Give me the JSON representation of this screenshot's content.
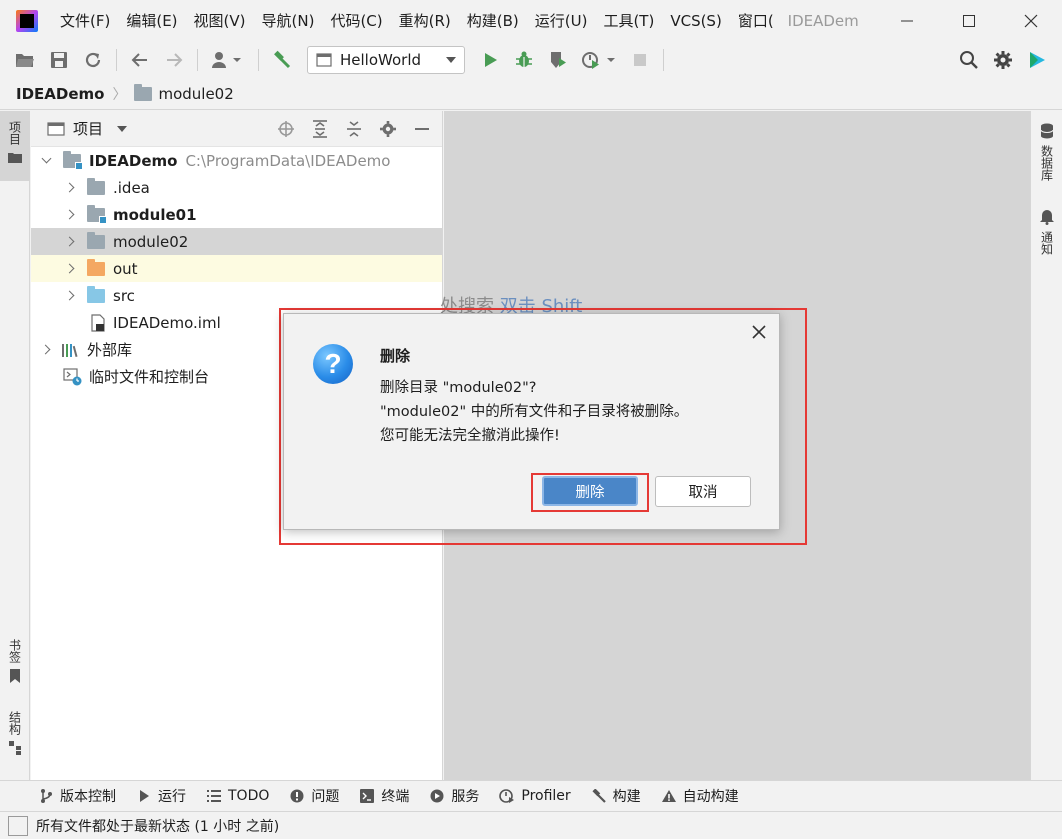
{
  "menu": {
    "items": [
      "文件(F)",
      "编辑(E)",
      "视图(V)",
      "导航(N)",
      "代码(C)",
      "重构(R)",
      "构建(B)",
      "运行(U)",
      "工具(T)",
      "VCS(S)",
      "窗口("
    ],
    "title": "IDEADem"
  },
  "toolbar": {
    "run_config": "HelloWorld"
  },
  "breadcrumb": {
    "root": "IDEADemo",
    "child": "module02"
  },
  "left_strip": {
    "project": "项目",
    "bookmarks": "书签",
    "structure": "结构"
  },
  "right_strip": {
    "database": "数据库",
    "notifications": "通知"
  },
  "project_panel": {
    "title": "项目",
    "tree": {
      "root_label": "IDEADemo",
      "root_path": "C:\\ProgramData\\IDEADemo",
      "idea": ".idea",
      "module01": "module01",
      "module02": "module02",
      "out": "out",
      "src": "src",
      "iml": "IDEADemo.iml",
      "external_libs": "外部库",
      "scratches": "临时文件和控制台"
    }
  },
  "editor": {
    "hint_prefix": "处搜索",
    "hint_key": "双击 Shift"
  },
  "dialog": {
    "title": "删除",
    "line1": "删除目录 \"module02\"?",
    "line2": "\"module02\" 中的所有文件和子目录将被删除。",
    "line3": "您可能无法完全撤消此操作!",
    "confirm": "删除",
    "cancel": "取消"
  },
  "bottom_bar": {
    "vcs": "版本控制",
    "run": "运行",
    "todo": "TODO",
    "problems": "问题",
    "terminal": "终端",
    "services": "服务",
    "profiler": "Profiler",
    "build": "构建",
    "auto_build": "自动构建"
  },
  "status": {
    "text": "所有文件都处于最新状态 (1 小时 之前)"
  }
}
